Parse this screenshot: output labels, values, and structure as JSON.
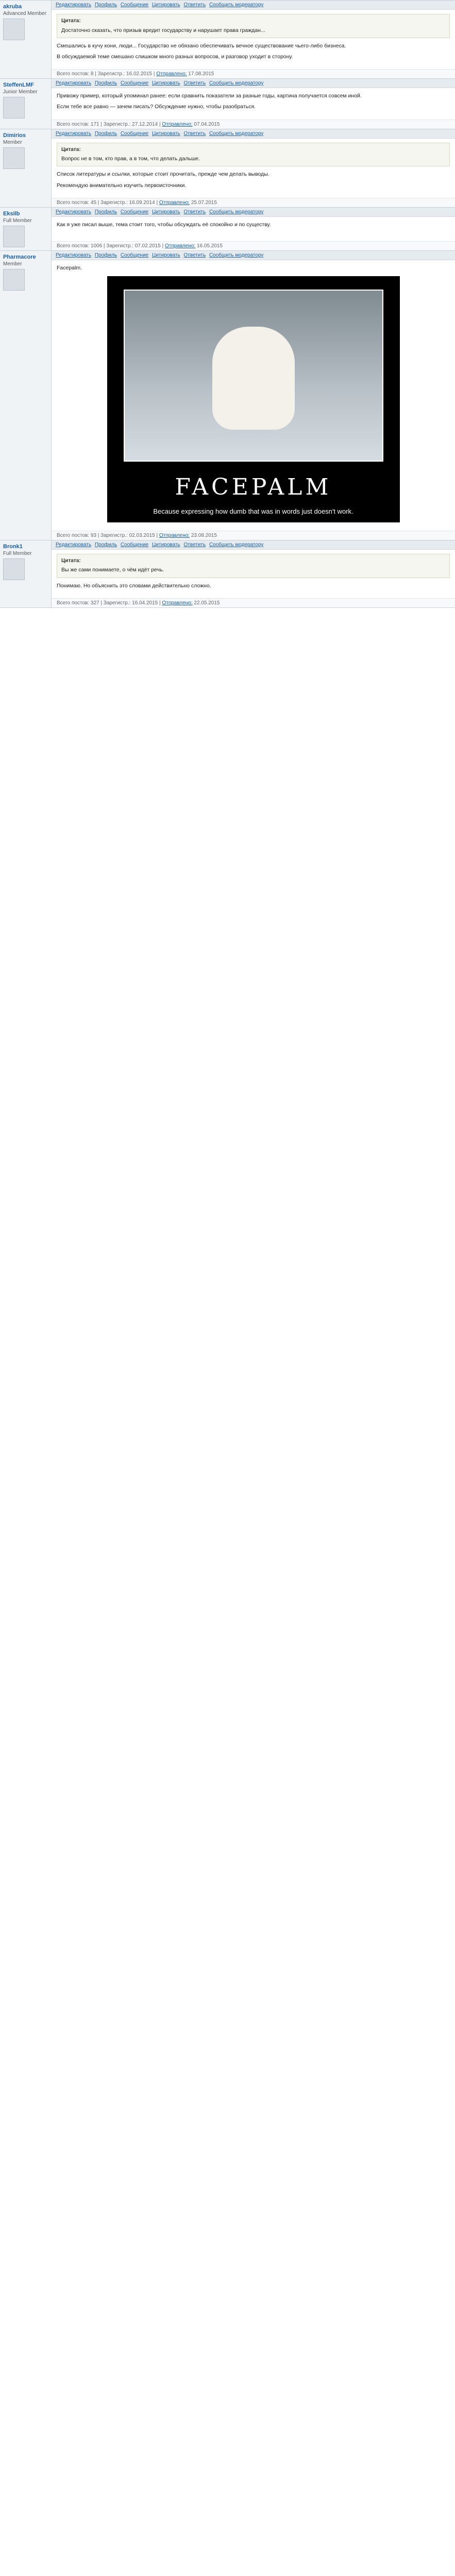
{
  "toolbar": {
    "links": [
      "Редактировать",
      "Профиль",
      "Сообщение",
      "Цитировать",
      "Ответить",
      "Сообщить модератору"
    ]
  },
  "meta_labels": {
    "posts": "Всего постов:",
    "registered": "Зарегистр.:",
    "sent": "Отправлено:"
  },
  "posts": [
    {
      "author": "akruba",
      "rank": "Advanced Member",
      "quote_head": "Цитата:",
      "quote": "Достаточно сказать, что призыв вредит государству и нарушает права граждан...",
      "text": [
        "Смешались в кучу кони, люди... Государство не обязано обеспечивать вечное существование чьего-либо бизнеса.",
        "В обсуждаемой теме смешано слишком много разных вопросов, и разговор уходит в сторону."
      ],
      "posts_count": "8",
      "registered": "16.02.2015",
      "sent": "17.08.2015"
    },
    {
      "author": "SteffenLMF",
      "rank": "Junior Member",
      "quote_head": "",
      "quote": "",
      "text": [
        "Привожу пример, который упоминал ранее: если сравнить показатели за разные годы, картина получается совсем иной.",
        "Если тебе все равно — зачем писать? Обсуждение нужно, чтобы разобраться."
      ],
      "posts_count": "171",
      "registered": "27.12.2014",
      "sent": "07.04.2015"
    },
    {
      "author": "Dimirios",
      "rank": "Member",
      "quote_head": "Цитата:",
      "quote": "Вопрос не в том, кто прав, а в том, что делать дальше.",
      "text": [
        "Список литературы и ссылки, которые стоит прочитать, прежде чем делать выводы.",
        "Рекомендую внимательно изучить первоисточники."
      ],
      "posts_count": "45",
      "registered": "16.09.2014",
      "sent": "25.07.2015"
    },
    {
      "author": "Eksilb",
      "rank": "Full Member",
      "quote_head": "",
      "quote": "",
      "text": [
        "Как я уже писал выше, тема стоит того, чтобы обсуждать её спокойно и по существу."
      ],
      "posts_count": "1006",
      "registered": "07.02.2015",
      "sent": "16.05.2015"
    },
    {
      "author": "Pharmacore",
      "rank": "Member",
      "quote_head": "",
      "quote": "",
      "text": [
        "Facepalm."
      ],
      "posts_count": "93",
      "registered": "02.03.2015",
      "sent": "23.08.2015"
    },
    {
      "author": "Bronk1",
      "rank": "Full Member",
      "quote_head": "Цитата:",
      "quote": "Вы же сами понимаете, о чём идёт речь.",
      "text": [
        "Понимаю. Но объяснить это словами действительно сложно."
      ],
      "posts_count": "327",
      "registered": "16.04.2015",
      "sent": "22.05.2015"
    }
  ],
  "facepalm": {
    "title": "FACEPALM",
    "caption": "Because expressing how dumb that was in words just doesn't work."
  }
}
